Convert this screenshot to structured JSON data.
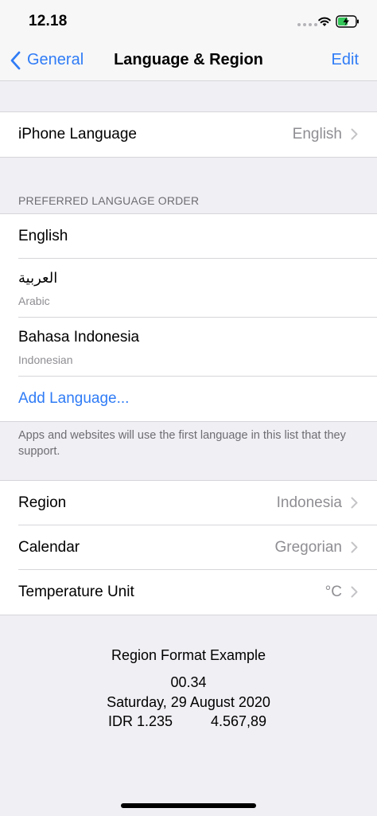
{
  "status_bar": {
    "time": "12.18",
    "icons": [
      "cellular-signal-icon",
      "wifi-icon",
      "battery-charging-icon"
    ]
  },
  "nav": {
    "back_label": "General",
    "title": "Language & Region",
    "edit_label": "Edit",
    "accent_color": "#2f7cf6"
  },
  "iphone_language": {
    "label": "iPhone Language",
    "value": "English"
  },
  "preferred_order": {
    "header": "PREFERRED LANGUAGE ORDER",
    "languages": [
      {
        "title": "English",
        "subtitle": ""
      },
      {
        "title": "العربية",
        "subtitle": "Arabic"
      },
      {
        "title": "Bahasa Indonesia",
        "subtitle": "Indonesian"
      }
    ],
    "add_label": "Add Language...",
    "footer": "Apps and websites will use the first language in this list that they support."
  },
  "settings": [
    {
      "label": "Region",
      "value": "Indonesia"
    },
    {
      "label": "Calendar",
      "value": "Gregorian"
    },
    {
      "label": "Temperature Unit",
      "value": "°C"
    }
  ],
  "format_example": {
    "title": "Region Format Example",
    "time": "00.34",
    "date": "Saturday, 29 August 2020",
    "currency": "IDR 1.235",
    "number": "4.567,89"
  }
}
